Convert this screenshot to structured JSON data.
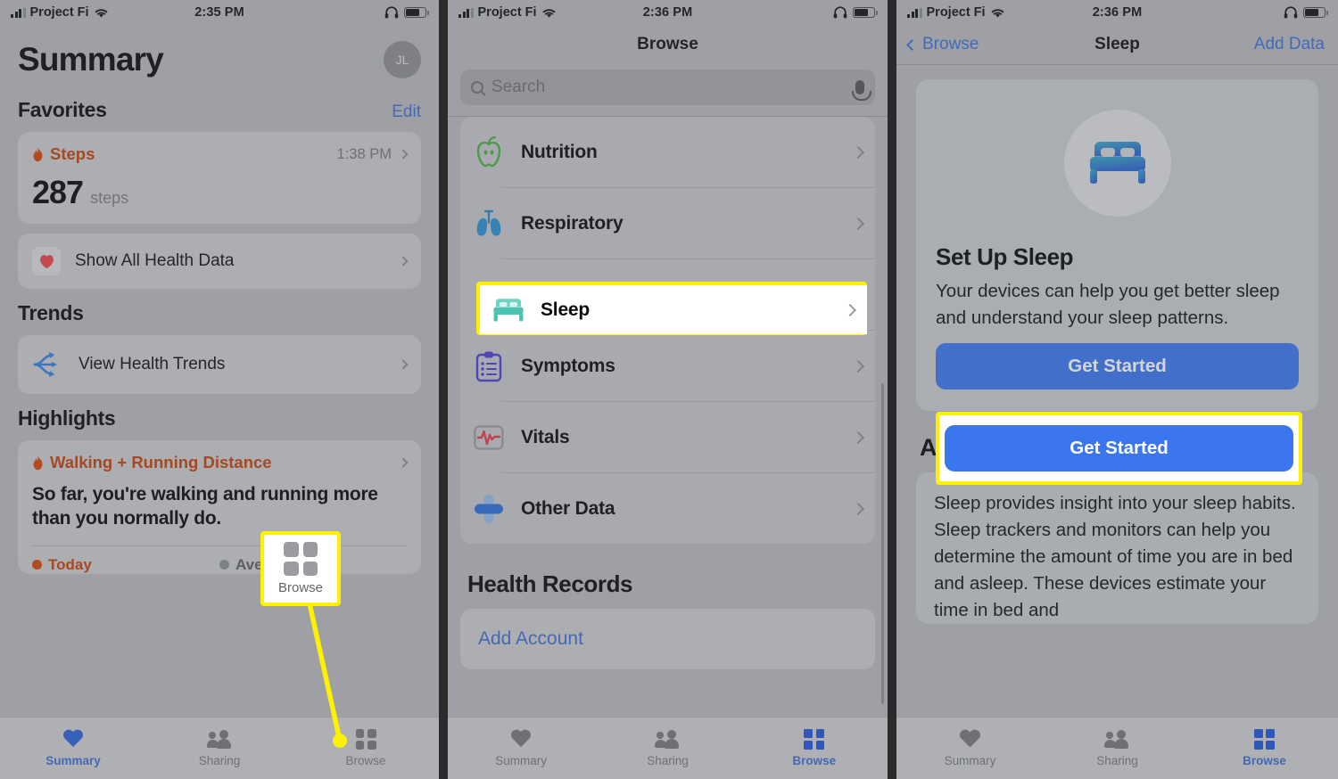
{
  "panels": [
    {
      "status": {
        "carrier": "Project Fi",
        "time": "2:35 PM"
      },
      "title": "Summary",
      "avatar": "JL",
      "favorites": {
        "heading": "Favorites",
        "edit": "Edit"
      },
      "steps_card": {
        "name": "Steps",
        "time": "1:38 PM",
        "value": "287",
        "unit": "steps"
      },
      "show_all": "Show All Health Data",
      "trends": {
        "heading": "Trends",
        "row": "View Health Trends"
      },
      "highlights": {
        "heading": "Highlights",
        "metric": "Walking + Running Distance",
        "body": "So far, you're walking and running more than you normally do.",
        "legend_today": "Today",
        "legend_average": "Average"
      },
      "tabs": [
        {
          "label": "Summary",
          "icon": "heart-icon",
          "active": true
        },
        {
          "label": "Sharing",
          "icon": "people-icon",
          "active": false
        },
        {
          "label": "Browse",
          "icon": "grid-icon",
          "active": false
        }
      ],
      "callout": {
        "label": "Browse",
        "icon": "grid-icon"
      }
    },
    {
      "status": {
        "carrier": "Project Fi",
        "time": "2:36 PM"
      },
      "title": "Browse",
      "search_placeholder": "Search",
      "rows": [
        {
          "label": "Nutrition",
          "icon": "apple-icon"
        },
        {
          "label": "Respiratory",
          "icon": "lungs-icon"
        },
        {
          "label": "Sleep",
          "icon": "bed-icon",
          "highlighted": true
        },
        {
          "label": "Symptoms",
          "icon": "clipboard-icon"
        },
        {
          "label": "Vitals",
          "icon": "heart-rate-monitor-icon"
        },
        {
          "label": "Other Data",
          "icon": "plus-cross-icon"
        }
      ],
      "health_records": {
        "heading": "Health Records",
        "add_account": "Add Account"
      },
      "tabs": [
        {
          "label": "Summary",
          "icon": "heart-icon",
          "active": false
        },
        {
          "label": "Sharing",
          "icon": "people-icon",
          "active": false
        },
        {
          "label": "Browse",
          "icon": "grid-icon",
          "active": true
        }
      ]
    },
    {
      "status": {
        "carrier": "Project Fi",
        "time": "2:36 PM"
      },
      "nav": {
        "back": "Browse",
        "title": "Sleep",
        "action": "Add Data"
      },
      "setup": {
        "heading": "Set Up Sleep",
        "body": "Your devices can help you get better sleep and understand your sleep patterns.",
        "button": "Get Started"
      },
      "about": {
        "heading": "About Sleep",
        "body": "Sleep provides insight into your sleep habits. Sleep trackers and monitors can help you determine the amount of time you are in bed and asleep. These devices estimate your time in bed and"
      },
      "tabs": [
        {
          "label": "Summary",
          "icon": "heart-icon",
          "active": false
        },
        {
          "label": "Sharing",
          "icon": "people-icon",
          "active": false
        },
        {
          "label": "Browse",
          "icon": "grid-icon",
          "active": true
        }
      ]
    }
  ],
  "colors": {
    "highlight_yellow": "#fff200",
    "ios_blue": "#3b76ee",
    "accent_orange": "#c2410c",
    "sleep_teal": "#5ecfc0",
    "tab_inactive": "#76777c"
  }
}
